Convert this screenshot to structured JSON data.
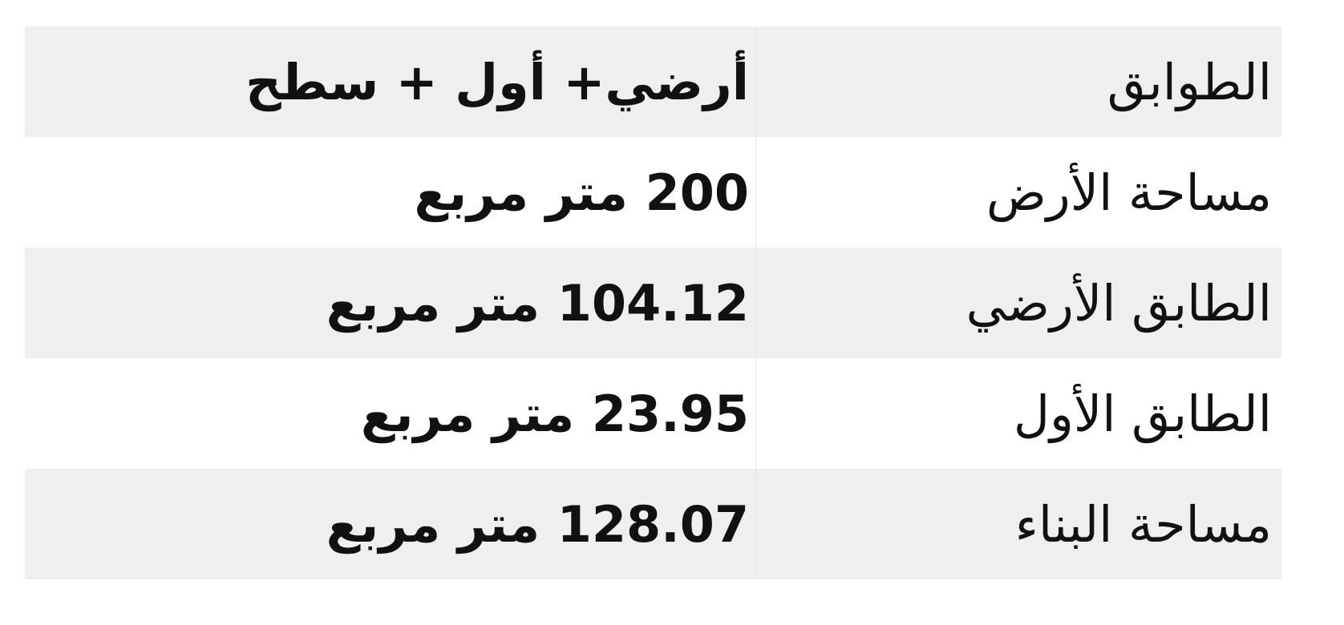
{
  "specs": {
    "rows": [
      {
        "label": "الطوابق",
        "value": "أرضي+ أول + سطح"
      },
      {
        "label": "مساحة الأرض",
        "value": "200 متر مربع"
      },
      {
        "label": "الطابق الأرضي",
        "value": "104.12 متر مربع"
      },
      {
        "label": "الطابق الأول",
        "value": "23.95 متر مربع"
      },
      {
        "label": "مساحة البناء",
        "value": "128.07 متر مربع"
      }
    ]
  }
}
